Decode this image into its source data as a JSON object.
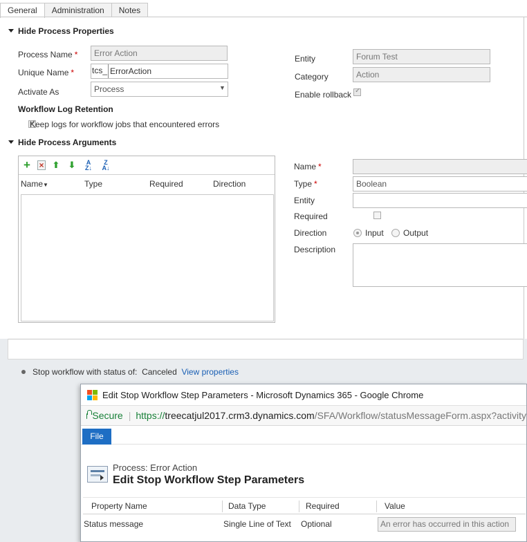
{
  "tabs": [
    "General",
    "Administration",
    "Notes"
  ],
  "process_properties": {
    "section_title": "Hide Process Properties",
    "process_name_label": "Process Name",
    "process_name_value": "Error Action",
    "unique_name_label": "Unique Name",
    "unique_name_prefix": "tcs_",
    "unique_name_value": "ErrorAction",
    "activate_as_label": "Activate As",
    "activate_as_value": "Process",
    "entity_label": "Entity",
    "entity_value": "Forum Test",
    "category_label": "Category",
    "category_value": "Action",
    "enable_rollback_label": "Enable rollback",
    "log_retention_title": "Workflow Log Retention",
    "keep_logs_label": "Keep logs for workflow jobs that encountered errors"
  },
  "process_arguments": {
    "section_title": "Hide Process Arguments",
    "columns": [
      "Name",
      "Type",
      "Required",
      "Direction"
    ],
    "name_label": "Name",
    "type_label": "Type",
    "type_value": "Boolean",
    "entity_label": "Entity",
    "required_label": "Required",
    "direction_label": "Direction",
    "direction_input": "Input",
    "direction_output": "Output",
    "description_label": "Description"
  },
  "step": {
    "prefix": "Stop workflow with status of:",
    "status": "Canceled",
    "link": "View properties"
  },
  "dialog": {
    "window_title": "Edit Stop Workflow Step Parameters - Microsoft Dynamics 365 - Google Chrome",
    "secure_label": "Secure",
    "url_scheme": "https://",
    "url_host": "treecatjul2017.crm3.dynamics.com",
    "url_path": "/SFA/Workflow/statusMessageForm.aspx?activity",
    "file_tab": "File",
    "process_line": "Process: Error Action",
    "heading": "Edit Stop Workflow Step Parameters",
    "columns": [
      "Property Name",
      "Data Type",
      "Required",
      "Value"
    ],
    "row": {
      "property": "Status message",
      "data_type": "Single Line of Text",
      "required": "Optional",
      "value": "An error has occurred in this action"
    }
  },
  "colors": {
    "required_star": "#cc0000",
    "link": "#1a5fb4",
    "file_tab": "#1e6ec4",
    "secure_green": "#188038"
  }
}
